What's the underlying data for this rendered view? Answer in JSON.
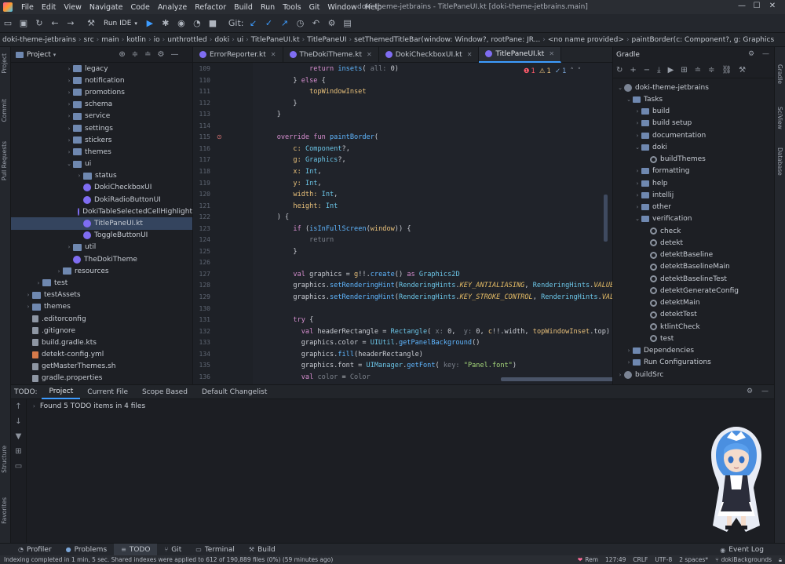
{
  "menu": {
    "items": [
      "File",
      "Edit",
      "View",
      "Navigate",
      "Code",
      "Analyze",
      "Refactor",
      "Build",
      "Run",
      "Tools",
      "Git",
      "Window",
      "Help"
    ],
    "window_title": "doki-theme-jetbrains - TitlePaneUI.kt [doki-theme-jetbrains.main]"
  },
  "toolbar": {
    "run_config": "Run IDE",
    "git_label": "Git:"
  },
  "breadcrumbs": [
    "doki-theme-jetbrains",
    "src",
    "main",
    "kotlin",
    "io",
    "unthrottled",
    "doki",
    "ui",
    "TitlePaneUI.kt",
    "TitlePaneUI",
    "setThemedTitleBar(window: Window?, rootPane: JR...",
    "<no name provided>",
    "paintBorder(c: Component?, g: Graphics"
  ],
  "left_stripe": [
    "Project",
    "Commit",
    "Pull Requests",
    "Structure",
    "Favorites"
  ],
  "project": {
    "title": "Project",
    "items": [
      {
        "label": "legacy",
        "depth": 5,
        "arrow": "›",
        "icon": "folder"
      },
      {
        "label": "notification",
        "depth": 5,
        "arrow": "›",
        "icon": "folder"
      },
      {
        "label": "promotions",
        "depth": 5,
        "arrow": "›",
        "icon": "folder"
      },
      {
        "label": "schema",
        "depth": 5,
        "arrow": "›",
        "icon": "folder"
      },
      {
        "label": "service",
        "depth": 5,
        "arrow": "›",
        "icon": "folder"
      },
      {
        "label": "settings",
        "depth": 5,
        "arrow": "›",
        "icon": "folder"
      },
      {
        "label": "stickers",
        "depth": 5,
        "arrow": "›",
        "icon": "folder"
      },
      {
        "label": "themes",
        "depth": 5,
        "arrow": "›",
        "icon": "folder"
      },
      {
        "label": "ui",
        "depth": 5,
        "arrow": "⌄",
        "icon": "folder"
      },
      {
        "label": "status",
        "depth": 6,
        "arrow": "›",
        "icon": "folder"
      },
      {
        "label": "DokiCheckboxUI",
        "depth": 6,
        "arrow": "",
        "icon": "kt"
      },
      {
        "label": "DokiRadioButtonUI",
        "depth": 6,
        "arrow": "",
        "icon": "kt"
      },
      {
        "label": "DokiTableSelectedCellHighlight",
        "depth": 6,
        "arrow": "",
        "icon": "kt"
      },
      {
        "label": "TitlePaneUI.kt",
        "depth": 6,
        "arrow": "",
        "icon": "kt",
        "selected": true
      },
      {
        "label": "ToggleButtonUI",
        "depth": 6,
        "arrow": "",
        "icon": "kt"
      },
      {
        "label": "util",
        "depth": 5,
        "arrow": "›",
        "icon": "folder"
      },
      {
        "label": "TheDokiTheme",
        "depth": 5,
        "arrow": "",
        "icon": "kt"
      },
      {
        "label": "resources",
        "depth": 4,
        "arrow": "›",
        "icon": "folder"
      },
      {
        "label": "test",
        "depth": 2,
        "arrow": "›",
        "icon": "folder"
      },
      {
        "label": "testAssets",
        "depth": 1,
        "arrow": "›",
        "icon": "folder"
      },
      {
        "label": "themes",
        "depth": 1,
        "arrow": "›",
        "icon": "folder"
      },
      {
        "label": ".editorconfig",
        "depth": 1,
        "arrow": "",
        "icon": "file"
      },
      {
        "label": ".gitignore",
        "depth": 1,
        "arrow": "",
        "icon": "file"
      },
      {
        "label": "build.gradle.kts",
        "depth": 1,
        "arrow": "",
        "icon": "file"
      },
      {
        "label": "detekt-config.yml",
        "depth": 1,
        "arrow": "",
        "icon": "yml"
      },
      {
        "label": "getMasterThemes.sh",
        "depth": 1,
        "arrow": "",
        "icon": "file"
      },
      {
        "label": "gradle.properties",
        "depth": 1,
        "arrow": "",
        "icon": "file"
      }
    ]
  },
  "tabs": [
    {
      "label": "ErrorReporter.kt",
      "active": false
    },
    {
      "label": "TheDokiTheme.kt",
      "active": false
    },
    {
      "label": "DokiCheckboxUI.kt",
      "active": false
    },
    {
      "label": "TitlePaneUI.kt",
      "active": true
    }
  ],
  "editor": {
    "indicators": {
      "errors": "1",
      "warnings": "1",
      "ok": "1"
    },
    "lines": [
      {
        "n": "109",
        "html": "            <span class='kw'>return</span> <span class='fn'>insets</span>( <span class='mu'>all:</span> 0)"
      },
      {
        "n": "110",
        "html": "        } <span class='kw'>else</span> {"
      },
      {
        "n": "111",
        "html": "            <span class='pa'>topWindowInset</span>"
      },
      {
        "n": "112",
        "html": "        }"
      },
      {
        "n": "113",
        "html": "    }"
      },
      {
        "n": "114",
        "html": ""
      },
      {
        "n": "115",
        "html": "    <span class='kw'>override fun</span> <span class='fn'>paintBorder</span>("
      },
      {
        "n": "116",
        "html": "        <span class='pa'>c:</span> <span class='ty'>Component</span>?,"
      },
      {
        "n": "117",
        "html": "        <span class='pa'>g:</span> <span class='ty'>Graphics</span>?,"
      },
      {
        "n": "118",
        "html": "        <span class='pa'>x:</span> <span class='ty'>Int</span>,"
      },
      {
        "n": "119",
        "html": "        <span class='pa'>y:</span> <span class='ty'>Int</span>,"
      },
      {
        "n": "120",
        "html": "        <span class='pa'>width:</span> <span class='ty'>Int</span>,"
      },
      {
        "n": "121",
        "html": "        <span class='pa'>height:</span> <span class='ty'>Int</span>"
      },
      {
        "n": "122",
        "html": "    ) {"
      },
      {
        "n": "123",
        "html": "        <span class='kw'>if</span> (<span class='fn'>isInFullScreen</span>(<span class='pa'>window</span>)) {"
      },
      {
        "n": "124",
        "html": "            <span class='mu'>return</span>"
      },
      {
        "n": "125",
        "html": "        }"
      },
      {
        "n": "126",
        "html": ""
      },
      {
        "n": "127",
        "html": "        <span class='kw'>val</span> graphics = <span class='pa'>g</span>!!.<span class='fn'>create</span>() <span class='kw'>as</span> <span class='ty'>Graphics2D</span>"
      },
      {
        "n": "128",
        "html": "        graphics.<span class='fn'>setRenderingHint</span>(<span class='ty'>RenderingHints</span>.<span class='it'>KEY_ANTIALIASING</span>, <span class='ty'>RenderingHints</span>.<span class='it'>VALUE_A</span>"
      },
      {
        "n": "129",
        "html": "        graphics.<span class='fn'>setRenderingHint</span>(<span class='ty'>RenderingHints</span>.<span class='it'>KEY_STROKE_CONTROL</span>, <span class='ty'>RenderingHints</span>.<span class='it'>VALUE</span>"
      },
      {
        "n": "130",
        "html": ""
      },
      {
        "n": "131",
        "html": "        <span class='kw'>try</span> {"
      },
      {
        "n": "132",
        "html": "          <span class='kw'>val</span> headerRectangle = <span class='ty'>Rectangle</span>( <span class='mu'>x:</span> 0,  <span class='mu'>y:</span> 0, <span class='pa'>c</span>!!.width, <span class='pa'>topWindowInset</span>.top)"
      },
      {
        "n": "133",
        "html": "          graphics.color = <span class='ty'>UIUtil</span>.<span class='fn'>getPanelBackground</span>()"
      },
      {
        "n": "134",
        "html": "          graphics.<span class='fn'>fill</span>(headerRectangle)"
      },
      {
        "n": "135",
        "html": "          graphics.font = <span class='ty'>UIManager</span>.<span class='fn'>getFont</span>( <span class='mu'>key:</span> <span class='st'>\"Panel.font\"</span>)"
      },
      {
        "n": "136",
        "html": "          <span class='kw'>val</span> <span class='mu'>color</span> = <span class='mu'>Color</span>"
      }
    ]
  },
  "gradle": {
    "title": "Gradle",
    "items": [
      {
        "label": "doki-theme-jetbrains",
        "depth": 0,
        "arrow": "⌄",
        "icon": "gradle"
      },
      {
        "label": "Tasks",
        "depth": 1,
        "arrow": "⌄",
        "icon": "folder"
      },
      {
        "label": "build",
        "depth": 2,
        "arrow": "›",
        "icon": "folder"
      },
      {
        "label": "build setup",
        "depth": 2,
        "arrow": "›",
        "icon": "folder"
      },
      {
        "label": "documentation",
        "depth": 2,
        "arrow": "›",
        "icon": "folder"
      },
      {
        "label": "doki",
        "depth": 2,
        "arrow": "⌄",
        "icon": "folder"
      },
      {
        "label": "buildThemes",
        "depth": 3,
        "arrow": "",
        "icon": "gear"
      },
      {
        "label": "formatting",
        "depth": 2,
        "arrow": "›",
        "icon": "folder"
      },
      {
        "label": "help",
        "depth": 2,
        "arrow": "›",
        "icon": "folder"
      },
      {
        "label": "intellij",
        "depth": 2,
        "arrow": "›",
        "icon": "folder"
      },
      {
        "label": "other",
        "depth": 2,
        "arrow": "›",
        "icon": "folder"
      },
      {
        "label": "verification",
        "depth": 2,
        "arrow": "⌄",
        "icon": "folder"
      },
      {
        "label": "check",
        "depth": 3,
        "arrow": "",
        "icon": "gear"
      },
      {
        "label": "detekt",
        "depth": 3,
        "arrow": "",
        "icon": "gear"
      },
      {
        "label": "detektBaseline",
        "depth": 3,
        "arrow": "",
        "icon": "gear"
      },
      {
        "label": "detektBaselineMain",
        "depth": 3,
        "arrow": "",
        "icon": "gear"
      },
      {
        "label": "detektBaselineTest",
        "depth": 3,
        "arrow": "",
        "icon": "gear"
      },
      {
        "label": "detektGenerateConfig",
        "depth": 3,
        "arrow": "",
        "icon": "gear"
      },
      {
        "label": "detektMain",
        "depth": 3,
        "arrow": "",
        "icon": "gear"
      },
      {
        "label": "detektTest",
        "depth": 3,
        "arrow": "",
        "icon": "gear"
      },
      {
        "label": "ktlintCheck",
        "depth": 3,
        "arrow": "",
        "icon": "gear"
      },
      {
        "label": "test",
        "depth": 3,
        "arrow": "",
        "icon": "gear"
      },
      {
        "label": "Dependencies",
        "depth": 1,
        "arrow": "›",
        "icon": "folder"
      },
      {
        "label": "Run Configurations",
        "depth": 1,
        "arrow": "›",
        "icon": "folder"
      },
      {
        "label": "buildSrc",
        "depth": 0,
        "arrow": "›",
        "icon": "gradle"
      }
    ]
  },
  "right_stripe": [
    "Gradle",
    "SciView",
    "Database"
  ],
  "todo": {
    "label": "TODO:",
    "tabs": [
      {
        "label": "Project",
        "active": true
      },
      {
        "label": "Current File",
        "active": false
      },
      {
        "label": "Scope Based",
        "active": false
      },
      {
        "label": "Default Changelist",
        "active": false
      }
    ],
    "result": "Found 5 TODO items in 4 files"
  },
  "bottom_tools": [
    {
      "label": "Profiler",
      "icon": "profiler-icon",
      "glyph": "◔",
      "active": false
    },
    {
      "label": "Problems",
      "icon": "problems-icon",
      "glyph": "●",
      "active": false
    },
    {
      "label": "TODO",
      "icon": "todo-icon",
      "glyph": "≡",
      "active": true
    },
    {
      "label": "Git",
      "icon": "git-icon",
      "glyph": "⑂",
      "active": false
    },
    {
      "label": "Terminal",
      "icon": "terminal-icon",
      "glyph": "▭",
      "active": false
    },
    {
      "label": "Build",
      "icon": "build-icon",
      "glyph": "⚒",
      "active": false
    }
  ],
  "event_log": "Event Log",
  "status": {
    "message": "Indexing completed in 1 min, 5 sec. Shared indexes were applied to 612 of 190,889 files (0%) (59 minutes ago)",
    "rem": "Rem",
    "position": "127:49",
    "line_sep": "CRLF",
    "encoding": "UTF-8",
    "indent": "2 spaces*",
    "branch": "dokiBackgrounds"
  }
}
